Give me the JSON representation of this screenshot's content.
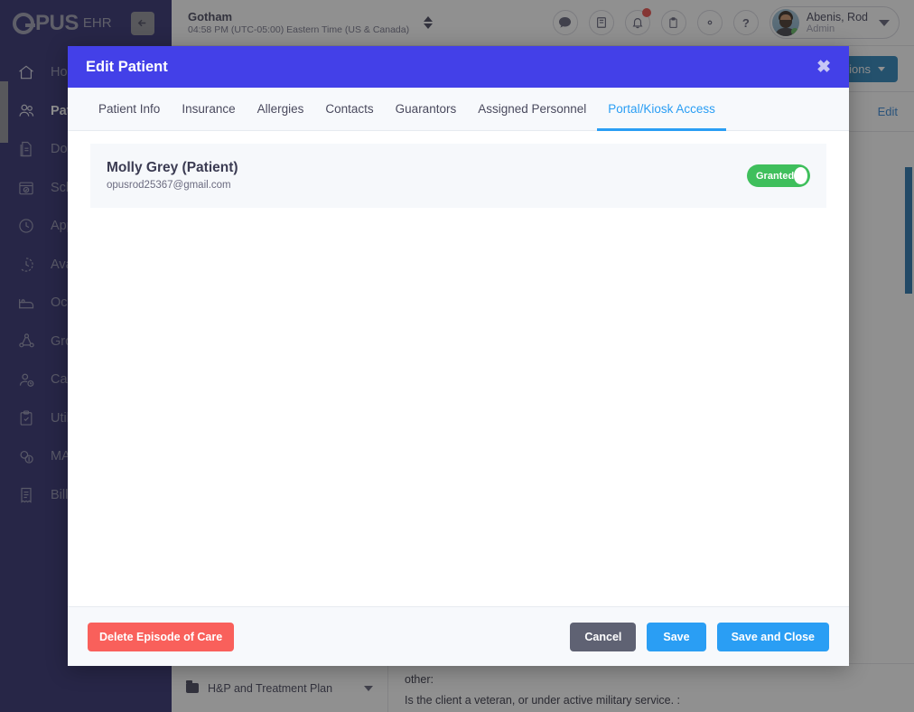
{
  "brand": {
    "logo_main": "PUS",
    "logo_sub": "EHR",
    "collapse_icon": "arrow-left-icon"
  },
  "sidebar": {
    "items": [
      {
        "label": "Home",
        "icon": "home-icon",
        "active": false
      },
      {
        "label": "Patients",
        "icon": "users-icon",
        "active": true
      },
      {
        "label": "Documents",
        "icon": "documents-icon",
        "active": false
      },
      {
        "label": "Schedule",
        "icon": "calendar-check-icon",
        "active": false
      },
      {
        "label": "Appointments",
        "icon": "clock-icon",
        "active": false
      },
      {
        "label": "Availability",
        "icon": "clock-dashed-icon",
        "active": false
      },
      {
        "label": "Occupancy",
        "icon": "bed-icon",
        "active": false
      },
      {
        "label": "Groups",
        "icon": "group-network-icon",
        "active": false
      },
      {
        "label": "Case Load",
        "icon": "user-clock-icon",
        "active": false
      },
      {
        "label": "Utilization Review",
        "icon": "clipboard-check-icon",
        "active": false
      },
      {
        "label": "MAR",
        "icon": "pills-icon",
        "active": false
      },
      {
        "label": "Billing",
        "icon": "receipt-dollar-icon",
        "active": false
      }
    ]
  },
  "topbar": {
    "location": "Gotham",
    "timezone": "04:58 PM (UTC-05:00) Eastern Time (US & Canada)",
    "location_switch_icon": "up-down-arrows-icon",
    "icons": [
      {
        "name": "chat-icon",
        "glyph": "💬"
      },
      {
        "name": "book-icon",
        "glyph": "📖"
      },
      {
        "name": "bell-icon",
        "glyph": "🔔",
        "badge": true
      },
      {
        "name": "clipboard-icon",
        "glyph": "📋"
      },
      {
        "name": "gear-icon",
        "glyph": "⚙"
      },
      {
        "name": "help-icon",
        "glyph": "?"
      }
    ],
    "user_name": "Abenis, Rod",
    "user_role": "Admin"
  },
  "background": {
    "options_label": "Options",
    "edit_label": "Edit",
    "folder_label": "H&P and Treatment Plan",
    "question_1": "other:",
    "question_2": "Is the client a veteran, or under active military service. :"
  },
  "modal": {
    "title": "Edit Patient",
    "close_label": "✖",
    "tabs": [
      {
        "label": "Patient Info",
        "active": false
      },
      {
        "label": "Insurance",
        "active": false
      },
      {
        "label": "Allergies",
        "active": false
      },
      {
        "label": "Contacts",
        "active": false
      },
      {
        "label": "Guarantors",
        "active": false
      },
      {
        "label": "Assigned Personnel",
        "active": false
      },
      {
        "label": "Portal/Kiosk Access",
        "active": true
      }
    ],
    "access": {
      "name": "Molly Grey (Patient)",
      "email": "opusrod25367@gmail.com",
      "toggle_label": "Granted",
      "toggle_on": true
    },
    "footer": {
      "delete_label": "Delete Episode of Care",
      "cancel_label": "Cancel",
      "save_label": "Save",
      "save_close_label": "Save and Close"
    }
  },
  "colors": {
    "sidebar_bg": "#252367",
    "modal_header": "#4340e8",
    "accent_blue": "#2a9ef4",
    "toggle_green": "#3fbf5c",
    "danger_red": "#f9605b",
    "options_blue": "#1f7bb6",
    "scrollbar_blue": "#1b6ca8"
  }
}
